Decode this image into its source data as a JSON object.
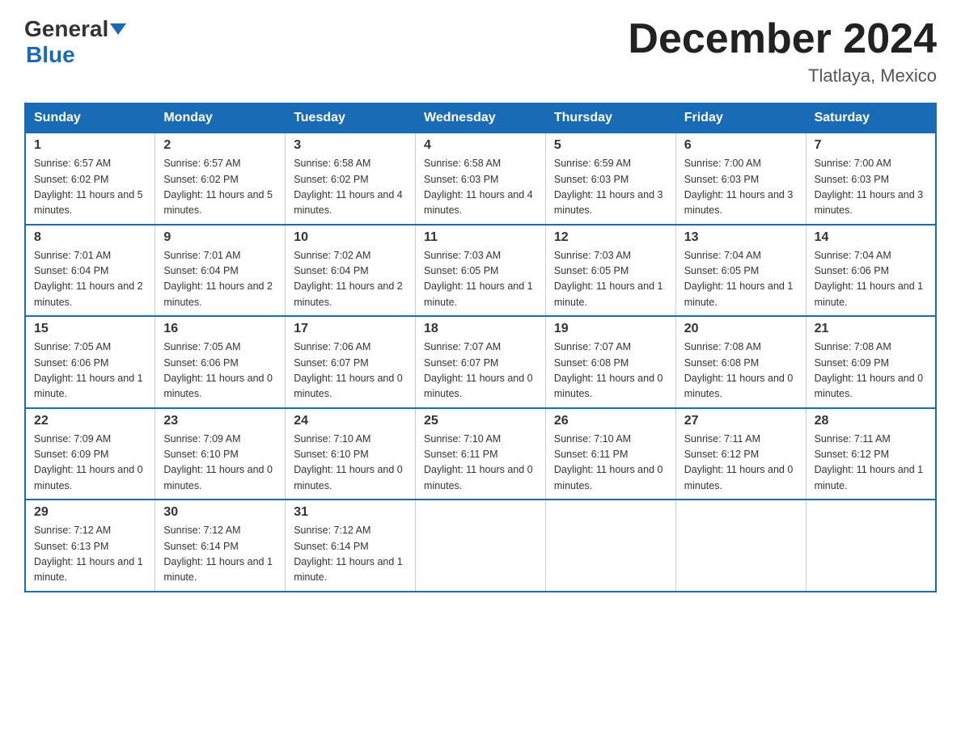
{
  "header": {
    "logo_general": "General",
    "logo_blue": "Blue",
    "month_title": "December 2024",
    "subtitle": "Tlatlaya, Mexico"
  },
  "days_of_week": [
    "Sunday",
    "Monday",
    "Tuesday",
    "Wednesday",
    "Thursday",
    "Friday",
    "Saturday"
  ],
  "weeks": [
    [
      {
        "num": "1",
        "sunrise": "6:57 AM",
        "sunset": "6:02 PM",
        "daylight": "11 hours and 5 minutes."
      },
      {
        "num": "2",
        "sunrise": "6:57 AM",
        "sunset": "6:02 PM",
        "daylight": "11 hours and 5 minutes."
      },
      {
        "num": "3",
        "sunrise": "6:58 AM",
        "sunset": "6:02 PM",
        "daylight": "11 hours and 4 minutes."
      },
      {
        "num": "4",
        "sunrise": "6:58 AM",
        "sunset": "6:03 PM",
        "daylight": "11 hours and 4 minutes."
      },
      {
        "num": "5",
        "sunrise": "6:59 AM",
        "sunset": "6:03 PM",
        "daylight": "11 hours and 3 minutes."
      },
      {
        "num": "6",
        "sunrise": "7:00 AM",
        "sunset": "6:03 PM",
        "daylight": "11 hours and 3 minutes."
      },
      {
        "num": "7",
        "sunrise": "7:00 AM",
        "sunset": "6:03 PM",
        "daylight": "11 hours and 3 minutes."
      }
    ],
    [
      {
        "num": "8",
        "sunrise": "7:01 AM",
        "sunset": "6:04 PM",
        "daylight": "11 hours and 2 minutes."
      },
      {
        "num": "9",
        "sunrise": "7:01 AM",
        "sunset": "6:04 PM",
        "daylight": "11 hours and 2 minutes."
      },
      {
        "num": "10",
        "sunrise": "7:02 AM",
        "sunset": "6:04 PM",
        "daylight": "11 hours and 2 minutes."
      },
      {
        "num": "11",
        "sunrise": "7:03 AM",
        "sunset": "6:05 PM",
        "daylight": "11 hours and 1 minute."
      },
      {
        "num": "12",
        "sunrise": "7:03 AM",
        "sunset": "6:05 PM",
        "daylight": "11 hours and 1 minute."
      },
      {
        "num": "13",
        "sunrise": "7:04 AM",
        "sunset": "6:05 PM",
        "daylight": "11 hours and 1 minute."
      },
      {
        "num": "14",
        "sunrise": "7:04 AM",
        "sunset": "6:06 PM",
        "daylight": "11 hours and 1 minute."
      }
    ],
    [
      {
        "num": "15",
        "sunrise": "7:05 AM",
        "sunset": "6:06 PM",
        "daylight": "11 hours and 1 minute."
      },
      {
        "num": "16",
        "sunrise": "7:05 AM",
        "sunset": "6:06 PM",
        "daylight": "11 hours and 0 minutes."
      },
      {
        "num": "17",
        "sunrise": "7:06 AM",
        "sunset": "6:07 PM",
        "daylight": "11 hours and 0 minutes."
      },
      {
        "num": "18",
        "sunrise": "7:07 AM",
        "sunset": "6:07 PM",
        "daylight": "11 hours and 0 minutes."
      },
      {
        "num": "19",
        "sunrise": "7:07 AM",
        "sunset": "6:08 PM",
        "daylight": "11 hours and 0 minutes."
      },
      {
        "num": "20",
        "sunrise": "7:08 AM",
        "sunset": "6:08 PM",
        "daylight": "11 hours and 0 minutes."
      },
      {
        "num": "21",
        "sunrise": "7:08 AM",
        "sunset": "6:09 PM",
        "daylight": "11 hours and 0 minutes."
      }
    ],
    [
      {
        "num": "22",
        "sunrise": "7:09 AM",
        "sunset": "6:09 PM",
        "daylight": "11 hours and 0 minutes."
      },
      {
        "num": "23",
        "sunrise": "7:09 AM",
        "sunset": "6:10 PM",
        "daylight": "11 hours and 0 minutes."
      },
      {
        "num": "24",
        "sunrise": "7:10 AM",
        "sunset": "6:10 PM",
        "daylight": "11 hours and 0 minutes."
      },
      {
        "num": "25",
        "sunrise": "7:10 AM",
        "sunset": "6:11 PM",
        "daylight": "11 hours and 0 minutes."
      },
      {
        "num": "26",
        "sunrise": "7:10 AM",
        "sunset": "6:11 PM",
        "daylight": "11 hours and 0 minutes."
      },
      {
        "num": "27",
        "sunrise": "7:11 AM",
        "sunset": "6:12 PM",
        "daylight": "11 hours and 0 minutes."
      },
      {
        "num": "28",
        "sunrise": "7:11 AM",
        "sunset": "6:12 PM",
        "daylight": "11 hours and 1 minute."
      }
    ],
    [
      {
        "num": "29",
        "sunrise": "7:12 AM",
        "sunset": "6:13 PM",
        "daylight": "11 hours and 1 minute."
      },
      {
        "num": "30",
        "sunrise": "7:12 AM",
        "sunset": "6:14 PM",
        "daylight": "11 hours and 1 minute."
      },
      {
        "num": "31",
        "sunrise": "7:12 AM",
        "sunset": "6:14 PM",
        "daylight": "11 hours and 1 minute."
      },
      null,
      null,
      null,
      null
    ]
  ]
}
